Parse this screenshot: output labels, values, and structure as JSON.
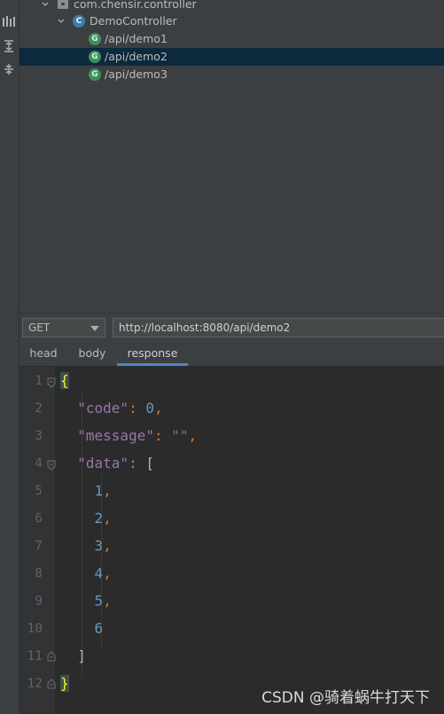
{
  "tree": {
    "package": "com.chensir.controller",
    "controller": "DemoController",
    "controller_icon": "C",
    "endpoint_icon": "G",
    "endpoints": [
      "/api/demo1",
      "/api/demo2",
      "/api/demo3"
    ],
    "selected_index": 1
  },
  "request": {
    "method": "GET",
    "url": "http://localhost:8080/api/demo2"
  },
  "tabs": [
    {
      "label": "head"
    },
    {
      "label": "body"
    },
    {
      "label": "response",
      "active": true
    }
  ],
  "editor": {
    "line_numbers": [
      "1",
      "2",
      "3",
      "4",
      "5",
      "6",
      "7",
      "8",
      "9",
      "10",
      "11",
      "12"
    ],
    "response": {
      "code_key": "\"code\"",
      "code_value": "0",
      "message_key": "\"message\"",
      "message_value": "\"\"",
      "data_key": "\"data\"",
      "data_values": [
        "1",
        "2",
        "3",
        "4",
        "5",
        "6"
      ]
    }
  },
  "watermark": "CSDN @骑着蜗牛打天下",
  "colors": {
    "selection": "#0d293e",
    "json_key": "#9876aa",
    "json_number": "#6897bb",
    "json_string": "#6a8759",
    "brace_highlight": "#ffef28",
    "tab_underline": "#4a88c7"
  }
}
